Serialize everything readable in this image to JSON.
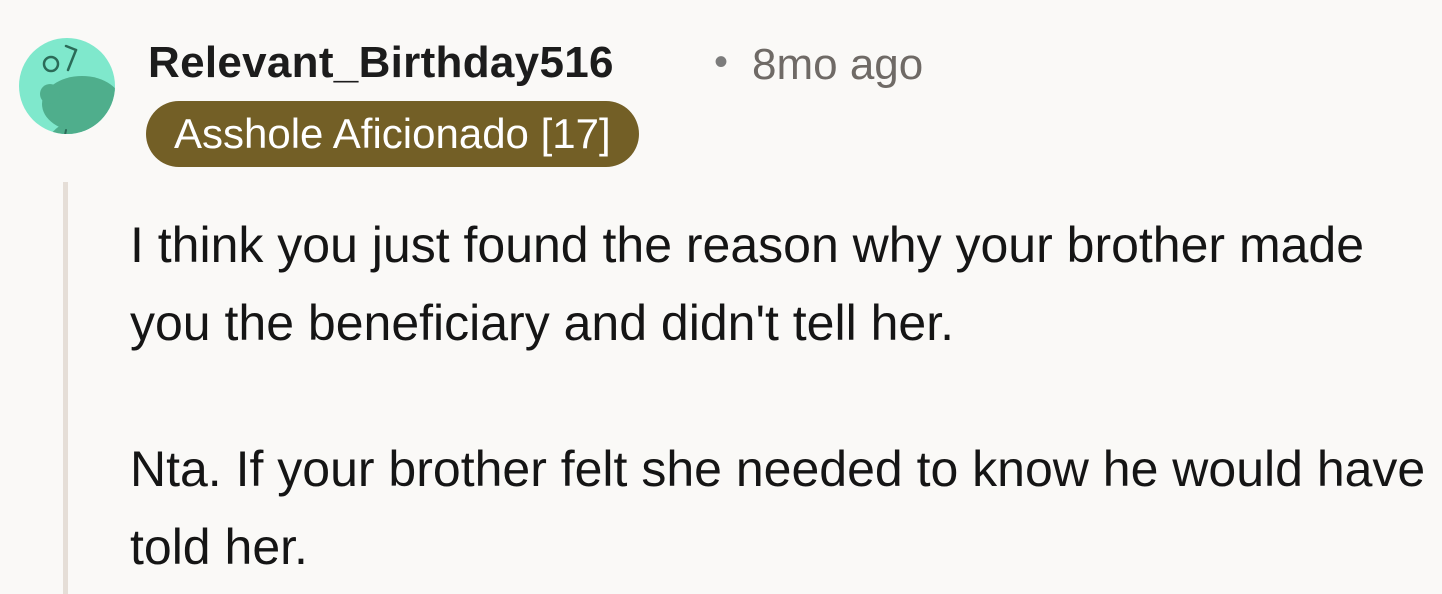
{
  "comment": {
    "author": "Relevant_Birthday516",
    "separator": "•",
    "timestamp": "8mo ago",
    "flair": "Asshole Aficionado [17]",
    "paragraphs": [
      "I think you just found the reason why your brother made you the beneficiary and didn't tell her.",
      "Nta. If your brother felt she needed to know he would have told her."
    ]
  },
  "avatar": {
    "icon": "snoo-avatar-icon",
    "background_color": "#7fe8cc",
    "figure_color": "#4fae8c"
  },
  "colors": {
    "flair_background": "#735f26",
    "thread_line": "#e5ded7",
    "page_background": "#faf9f7"
  }
}
